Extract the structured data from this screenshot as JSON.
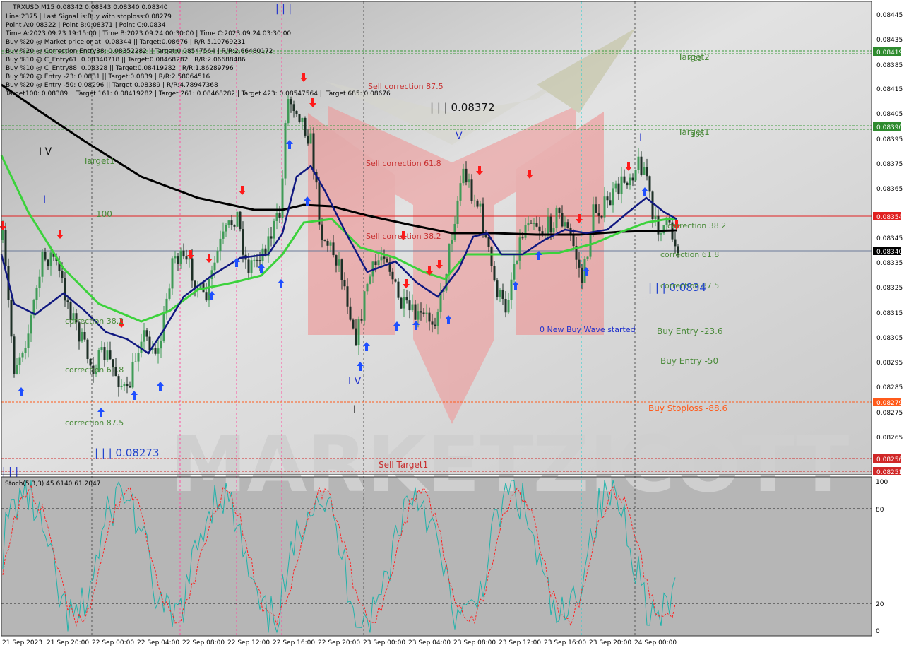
{
  "chart": {
    "symbol_line": "TRXUSD,M15  0.08342 0.08343 0.08340 0.08340",
    "info_lines": [
      "Line:2375 | Last Signal is:Buy with stoploss:0.08279",
      "Point A:0.08322 | Point B:0.08371 | Point C:0.0834",
      "Time A:2023.09.23 19:15:00 | Time B:2023.09.24 00:30:00 | Time C:2023.09.24 03:30:00",
      "Buy %20 @ Market price or at: 0.08344 || Target:0.08676 | R/R:5.10769231",
      "Buy %20 @ Correction Entry38: 0.08352282 || Target:0.08547564 | R/R:2.66480172",
      "Buy %10 @ C_Entry61: 0.08340718 || Target:0.08468282 | R/R:2.06688486",
      "Buy %10 @ C_Entry88: 0.08328 || Target:0.08419282 | R/R:1.86289796",
      "Buy %20 @ Entry -23: 0.0831 || Target:0.0839 | R/R:2.58064516",
      "Buy %20 @ Entry -50: 0.08296 || Target:0.08389 | R/R:4.78947368",
      "Target100: 0.08389 || Target 161: 0.08419282 | Target 261: 0.08468282 | Target 423: 0.08547564 || Target 685: 0.08676"
    ],
    "price_axis": [
      "0.08445",
      "0.08435",
      "0.08415",
      "0.08405",
      "0.08395",
      "0.08385",
      "0.08375",
      "0.08365",
      "0.08345",
      "0.08335",
      "0.08325",
      "0.08315",
      "0.08305",
      "0.08295",
      "0.08285",
      "0.08275",
      "0.08265"
    ],
    "price_tags": {
      "t1": {
        "text": "0.08419",
        "color": "#2e8b2e"
      },
      "t2": {
        "text": "0.08390",
        "color": "#2e8b2e"
      },
      "t3": {
        "text": "0.08354",
        "color": "#e02020"
      },
      "t4": {
        "text": "0.08340",
        "color": "#000000"
      },
      "t5": {
        "text": "0.08279",
        "color": "#ff5a1a"
      },
      "t6": {
        "text": "0.08256",
        "color": "#d02828"
      },
      "t7": {
        "text": "0.08251",
        "color": "#d02828"
      }
    },
    "labels": {
      "target2": "Target2",
      "target1_right": "Target1",
      "target1_left": "Target1",
      "label_100": "100",
      "label_423": "423",
      "label_100r": "100",
      "sell_c875": "Sell correction 87.5",
      "sell_c618": "Sell correction 61.8",
      "sell_c382": "Sell correction 38.2",
      "wave_high": "| | | 0.08372",
      "wave_low": "| | | 0.08273",
      "wave_c": "| | | 0.0834",
      "corr382_left": "correction 38.2",
      "corr618_left": "correction 61.8",
      "corr875_left": "correction 87.5",
      "corr382_right": "correction 38.2",
      "corr618_right": "correction 61.8",
      "corr875_right": "correction 87.5",
      "new_buy_wave": "0 New Buy Wave started",
      "buy_entry_236": "Buy Entry -23.6",
      "buy_entry_50": "Buy Entry -50",
      "buy_stoploss": "Buy Stoploss -88.6",
      "sell_target1": "Sell Target1",
      "wave_iii_top": "| | |",
      "wave_iv_left": "I V",
      "wave_i_left": "I",
      "wave_iv_mid": "I V",
      "wave_v": "V",
      "wave_i_right": "I",
      "wave_i_bottom": "I",
      "wave_iii_bottom": "| | |"
    },
    "watermark": "MARKETZICOTT"
  },
  "oscillator": {
    "header": "Stoch(5,3,3) 45.6140 61.2047",
    "levels": [
      "100",
      "80",
      "20",
      "0"
    ]
  },
  "time_axis": [
    "21 Sep 2023",
    "21 Sep 20:00",
    "22 Sep 00:00",
    "22 Sep 04:00",
    "22 Sep 08:00",
    "22 Sep 12:00",
    "22 Sep 16:00",
    "22 Sep 20:00",
    "23 Sep 00:00",
    "23 Sep 04:00",
    "23 Sep 08:00",
    "23 Sep 12:00",
    "23 Sep 16:00",
    "23 Sep 20:00",
    "24 Sep 00:00"
  ],
  "colors": {
    "bull_candle": "#3f9b57",
    "bear_candle": "#1d2f26",
    "ma_green": "#3cd23c",
    "ma_blue": "#101880",
    "ma_black": "#000000",
    "buy_arrow": "#1f4fff",
    "sell_arrow": "#ff1a1a",
    "zone_red": "#f08080"
  }
}
